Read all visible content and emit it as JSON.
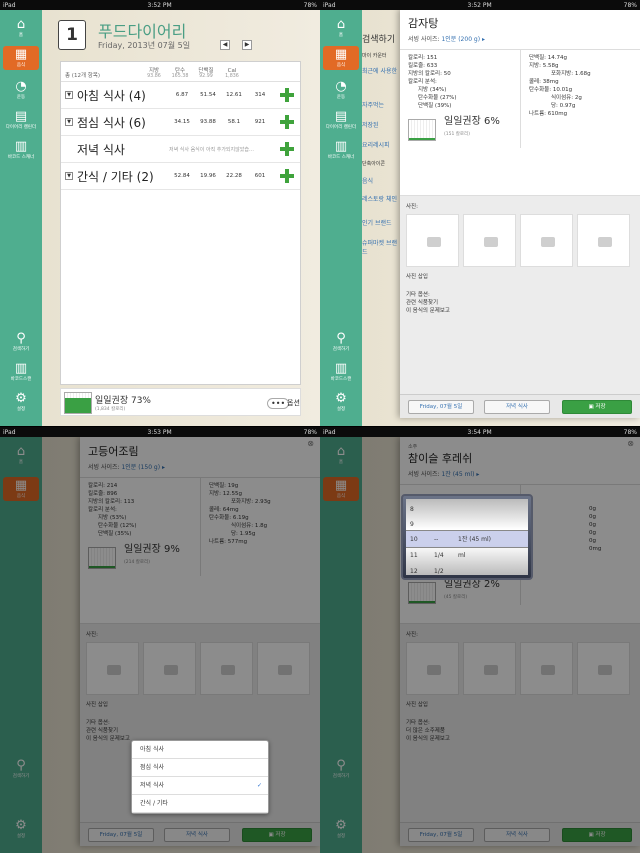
{
  "status": {
    "carrier": "iPad",
    "battery": "78%",
    "time_q1": "3:52 PM",
    "time_q2": "3:52 PM",
    "time_q3": "3:53 PM",
    "time_q4": "3:54 PM"
  },
  "nav": {
    "home": "홈",
    "meal": "음식",
    "exercise": "운동",
    "calendar": "다이어리 캘린더",
    "barcode": "바코드 스캐너",
    "search": "검색하기",
    "barcode2": "바코드스캔",
    "settings": "설정"
  },
  "diary": {
    "title": "푸드다이어리",
    "date": "Friday, 2013년 07월 5일",
    "total_label": "총 (12개 항목)",
    "cols": [
      "지방",
      "탄수",
      "단백질",
      "Cal"
    ],
    "totals": [
      "93.86",
      "165.38",
      "92.99",
      "1,836"
    ],
    "meals": [
      {
        "name": "아침 식사 (4)",
        "fat": "6.87",
        "carb": "51.54",
        "prot": "12.61",
        "cal": "314"
      },
      {
        "name": "점심 식사 (6)",
        "fat": "34.15",
        "carb": "93.88",
        "prot": "58.1",
        "cal": "921"
      },
      {
        "name": "저녁 식사",
        "hint": "저녁 식사 음식이 아직 추가되지않았습…"
      },
      {
        "name": "간식 / 기타 (2)",
        "fat": "52.84",
        "carb": "19.96",
        "prot": "22.28",
        "cal": "601"
      }
    ],
    "rdi_label": "일일권장 73%",
    "rdi_sub": "(1,834 칼로리)",
    "more": "옵션",
    "gauge": 0.73
  },
  "side_list": {
    "title": "검색하기",
    "tab": "마이 카운터",
    "recent": "최근에 사용한",
    "fav": "자주먹는",
    "saved": "저장된",
    "recipe": "요리레시피",
    "single": "단축아이콘",
    "food": "음식",
    "rest": "레스토랑 체인",
    "pop": "인기 브랜드",
    "super": "슈퍼마켓 브랜드"
  },
  "panel1": {
    "name": "감자탕",
    "serving_label": "서빙 사이즈:",
    "serving": "1인분 (200 g)",
    "left": [
      "칼로리: 151",
      "킬로줄: 633",
      "지방의 칼로리: 50",
      "칼로리 분석:"
    ],
    "breakdown": [
      "지방 (34%)",
      "탄수화물 (27%)",
      "단백질 (39%)"
    ],
    "right": [
      "단백질: 14.74g",
      "지방: 5.58g",
      "포화지방: 1.68g",
      "콜레: 38mg",
      "탄수화물: 10.01g",
      "식이섬유: 2g",
      "당: 0.97g",
      "나트륨: 610mg"
    ],
    "rdi": "일일권장 6%",
    "rdi_sub": "(151 칼로리)",
    "gauge": 0.06,
    "photos": "사진:",
    "insert": "사진 삽입",
    "other": "기타 옵션:",
    "related": "관련 식품찾기",
    "report": "이 음식의 문제보고",
    "btn_date": "Friday, 07월 5일",
    "btn_meal": "저녁 식사",
    "btn_save": "저장"
  },
  "panel2": {
    "name": "고등어조림",
    "serving_label": "서빙 사이즈:",
    "serving": "1인분 (150 g)",
    "left": [
      "칼로리: 214",
      "킬로줄: 896",
      "지방의 칼로리: 113",
      "칼로리 분석:"
    ],
    "breakdown": [
      "지방 (53%)",
      "탄수화물 (12%)",
      "단백질 (35%)"
    ],
    "right": [
      "단백질: 19g",
      "지방: 12.55g",
      "포화지방: 2.93g",
      "콜레: 64mg",
      "탄수화물: 6.19g",
      "식이섬유: 1.8g",
      "당: 1.95g",
      "나트륨: 577mg"
    ],
    "rdi": "일일권장 9%",
    "rdi_sub": "(214 칼로리)",
    "gauge": 0.09,
    "photos": "사진:",
    "insert": "사진 삽입",
    "other": "기타 옵션:",
    "related": "관련 식품찾기",
    "report": "이 음식의 문제보고",
    "menu": [
      "아침 식사",
      "점심 식사",
      "저녁 식사",
      "간식 / 기타"
    ],
    "btn_date": "Friday, 07월 5일",
    "btn_meal": "저녁 식사",
    "btn_save": "저장"
  },
  "panel3": {
    "category": "소주",
    "name": "참이슬 후레쉬",
    "serving_label": "서빙 사이즈:",
    "serving": "1잔 (45 ml)",
    "right_vals": [
      "0g",
      "0g",
      "0g",
      "0g",
      "0g",
      "0mg"
    ],
    "rdi": "일일권장 2%",
    "rdi_sub": "(45 칼로리)",
    "gauge": 0.02,
    "picker_nums": [
      "8",
      "9",
      "10",
      "11",
      "12"
    ],
    "picker_frac": [
      "",
      "",
      "--",
      "1/4",
      "1/2"
    ],
    "picker_unit": [
      "",
      "",
      "1잔 (45 ml)",
      "ml",
      ""
    ],
    "photos": "사진:",
    "insert": "사진 삽입",
    "other": "기타 옵션:",
    "related": "더 많은 소주제품",
    "report": "이 음식의 문제보고",
    "btn_date": "Friday, 07월 5일",
    "btn_meal": "저녁 식사",
    "btn_save": "저장"
  }
}
